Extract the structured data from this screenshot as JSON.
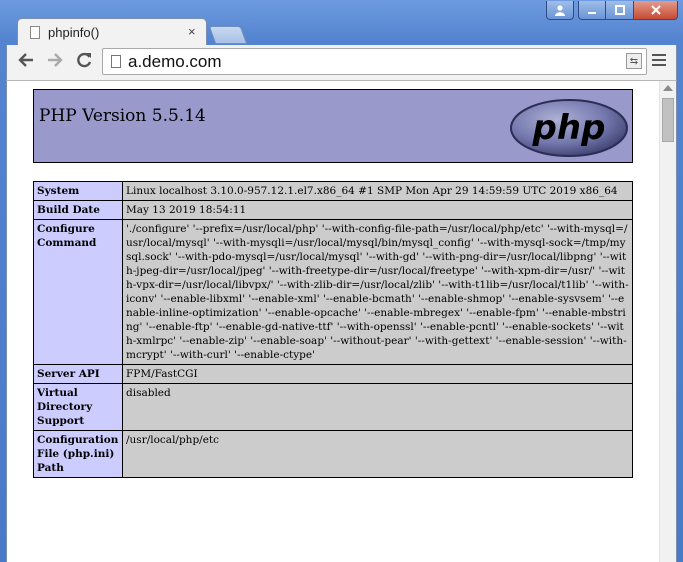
{
  "browser": {
    "tab_title": "phpinfo()",
    "tab_close_glyph": "×",
    "url": "a.demo.com",
    "colors": {
      "frame": "#5484cf",
      "toolbar": "#f2f2f2"
    }
  },
  "page": {
    "php_version": "PHP Version 5.5.14",
    "logo_text": "php",
    "colors": {
      "header_bg": "#9999cc",
      "key_bg": "#ccccff",
      "value_bg": "#cccccc"
    },
    "rows": [
      {
        "key": "System",
        "value": "Linux localhost 3.10.0-957.12.1.el7.x86_64 #1 SMP Mon Apr 29 14:59:59 UTC 2019 x86_64"
      },
      {
        "key": "Build Date",
        "value": "May 13 2019 18:54:11"
      },
      {
        "key": "Configure Command",
        "value": "'./configure' '--prefix=/usr/local/php' '--with-config-file-path=/usr/local/php/etc' '--with-mysql=/usr/local/mysql' '--with-mysqli=/usr/local/mysql/bin/mysql_config' '--with-mysql-sock=/tmp/mysql.sock' '--with-pdo-mysql=/usr/local/mysql' '--with-gd' '--with-png-dir=/usr/local/libpng' '--with-jpeg-dir=/usr/local/jpeg' '--with-freetype-dir=/usr/local/freetype' '--with-xpm-dir=/usr/' '--with-vpx-dir=/usr/local/libvpx/' '--with-zlib-dir=/usr/local/zlib' '--with-t1lib=/usr/local/t1lib' '--with-iconv' '--enable-libxml' '--enable-xml' '--enable-bcmath' '--enable-shmop' '--enable-sysvsem' '--enable-inline-optimization' '--enable-opcache' '--enable-mbregex' '--enable-fpm' '--enable-mbstring' '--enable-ftp' '--enable-gd-native-ttf' '--with-openssl' '--enable-pcntl' '--enable-sockets' '--with-xmlrpc' '--enable-zip' '--enable-soap' '--without-pear' '--with-gettext' '--enable-session' '--with-mcrypt' '--with-curl' '--enable-ctype'"
      },
      {
        "key": "Server API",
        "value": "FPM/FastCGI"
      },
      {
        "key": "Virtual Directory Support",
        "value": "disabled"
      },
      {
        "key": "Configuration File (php.ini) Path",
        "value": "/usr/local/php/etc"
      }
    ]
  }
}
